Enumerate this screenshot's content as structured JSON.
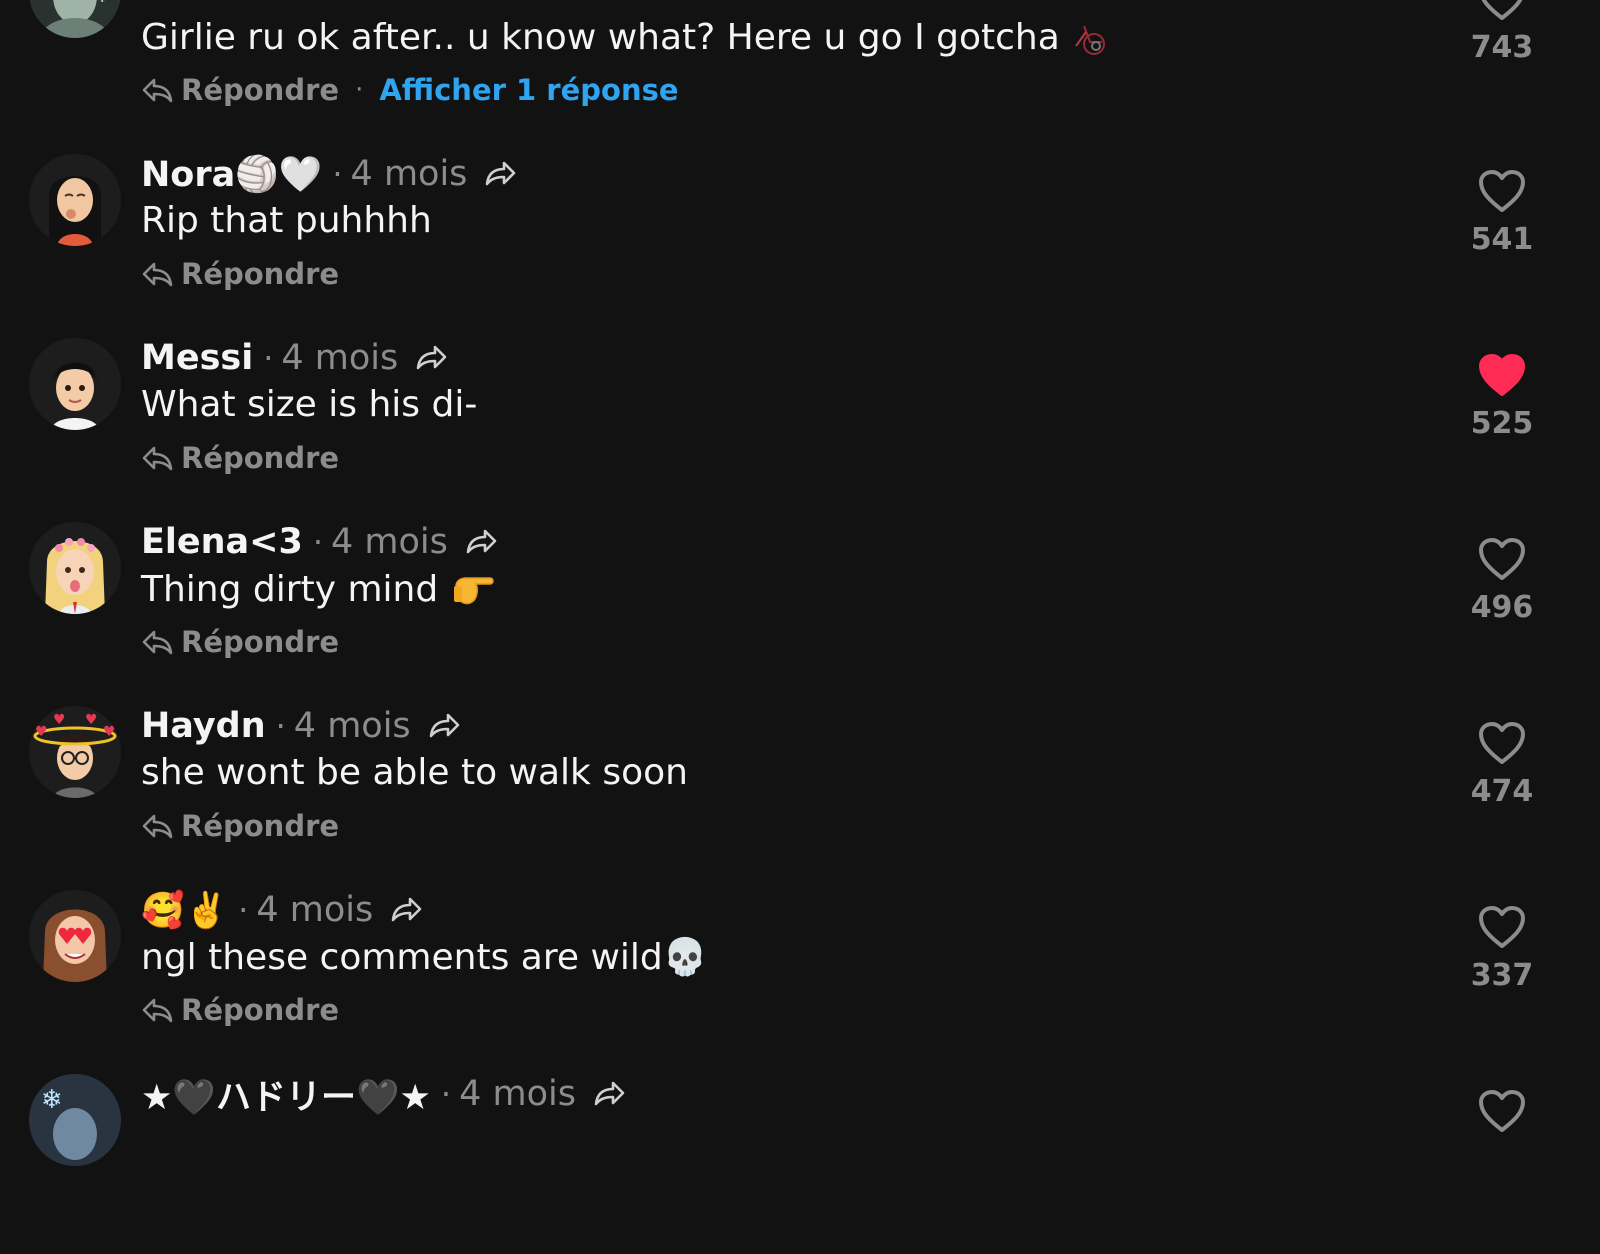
{
  "colors": {
    "background": "#121212",
    "text": "#f4f4f4",
    "muted": "#8c8c8c",
    "link": "#2fa4f0",
    "liked": "#fe2c55"
  },
  "comments": [
    {
      "username": "",
      "time": "",
      "text": "Girlie ru ok after.. u know what? Here u go I gotcha",
      "reply_label": "Répondre",
      "view_replies": "Afficher 1 réponse",
      "likes": "743",
      "liked": false
    },
    {
      "username": "Nora🏐🤍",
      "separator": "·",
      "time": "4 mois",
      "text": "Rip that puhhhh",
      "reply_label": "Répondre",
      "likes": "541",
      "liked": false
    },
    {
      "username": "Messi",
      "separator": "·",
      "time": "4 mois",
      "text": "What size is his di-",
      "reply_label": "Répondre",
      "likes": "525",
      "liked": true
    },
    {
      "username": "Elena<3",
      "separator": "·",
      "time": "4 mois",
      "text": "Thing dirty mind",
      "text_emoji": "👉",
      "reply_label": "Répondre",
      "likes": "496",
      "liked": false
    },
    {
      "username": "Haydn",
      "separator": "·",
      "time": "4 mois",
      "text": "she wont be able to walk soon",
      "reply_label": "Répondre",
      "likes": "474",
      "liked": false
    },
    {
      "username": "🥰✌️",
      "separator": "·",
      "time": "4 mois",
      "text": "ngl these comments are wild💀",
      "reply_label": "Répondre",
      "likes": "337",
      "liked": false
    },
    {
      "username": "★🖤ハドリー🖤★",
      "separator": "·",
      "time": "4 mois"
    }
  ]
}
